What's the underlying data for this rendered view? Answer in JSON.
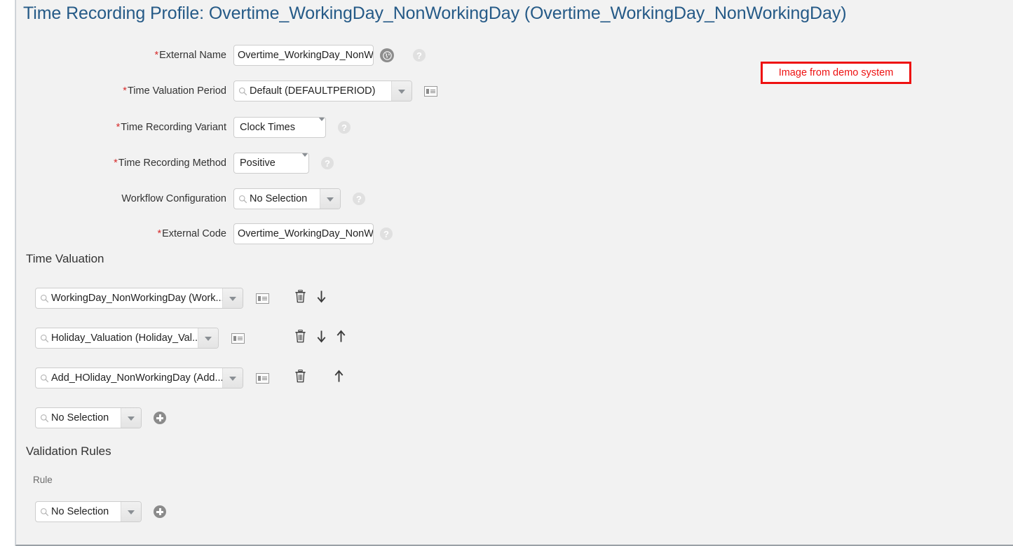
{
  "page": {
    "title": "Time Recording Profile: Overtime_WorkingDay_NonWorkingDay (Overtime_WorkingDay_NonWorkingDay)",
    "note": "Image from demo system",
    "note_color": "#ee1111",
    "title_color": "#255a87",
    "background": "#f2f2f2"
  },
  "form": {
    "external_name": {
      "label": "External Name",
      "value": "Overtime_WorkingDay_NonW",
      "required": "*"
    },
    "time_valuation_period": {
      "label": "Time Valuation Period",
      "value": "Default (DEFAULTPERIOD)",
      "required": "*"
    },
    "time_recording_variant": {
      "label": "Time Recording Variant",
      "value": "Clock Times",
      "required": "*"
    },
    "time_recording_method": {
      "label": "Time Recording Method",
      "value": "Positive",
      "required": "*"
    },
    "workflow_configuration": {
      "label": "Workflow Configuration",
      "value": "No Selection",
      "required": ""
    },
    "external_code": {
      "label": "External Code",
      "value": "Overtime_WorkingDay_NonW",
      "required": "*"
    }
  },
  "time_valuation": {
    "heading": "Time Valuation",
    "rows": [
      {
        "value": "WorkingDay_NonWorkingDay (Work..."
      },
      {
        "value": "Holiday_Valuation (Holiday_Val..."
      },
      {
        "value": "Add_HOliday_NonWorkingDay (Add..."
      }
    ],
    "new_row": {
      "value": "No Selection"
    }
  },
  "validation_rules": {
    "heading": "Validation Rules",
    "column_label": "Rule",
    "new_row": {
      "value": "No Selection"
    }
  },
  "icons": {
    "help": "?",
    "search": "search-icon",
    "globe": "globe-icon",
    "details": "details-icon",
    "delete": "trash-icon",
    "move_down": "arrow-down-icon",
    "move_up": "arrow-up-icon",
    "add": "plus-icon"
  }
}
